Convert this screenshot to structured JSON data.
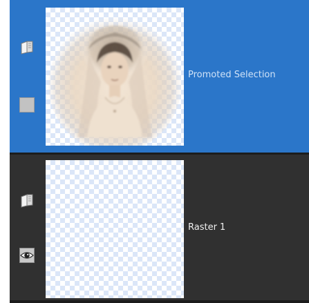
{
  "layers": [
    {
      "name": "Promoted Selection",
      "selected": true,
      "icons": [
        "layer-properties-icon",
        "visibility-toggle-icon"
      ],
      "thumbnail": "vintage-bride-portrait-on-transparency"
    },
    {
      "name": "Raster 1",
      "selected": false,
      "icons": [
        "layer-properties-icon",
        "eye-icon"
      ],
      "thumbnail": "empty-transparency"
    }
  ],
  "colors": {
    "selected_row": "#2b76c9",
    "panel_background": "#303030",
    "selected_label": "#cfe2f7",
    "label": "#f0f0f0"
  }
}
